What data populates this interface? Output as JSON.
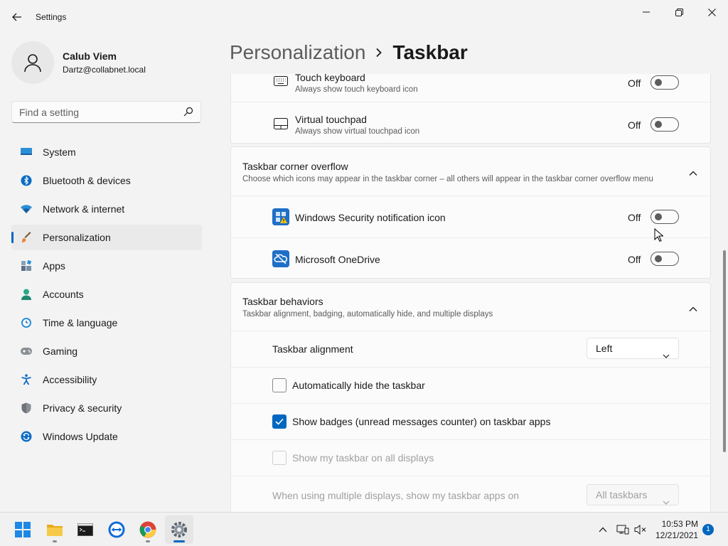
{
  "window": {
    "title": "Settings",
    "controls": {
      "minimize": "minimize-icon",
      "maximize": "restore-icon",
      "close": "close-icon"
    }
  },
  "profile": {
    "name": "Calub Viem",
    "email": "Dartz@collabnet.local",
    "avatar_icon": "person-icon"
  },
  "search": {
    "placeholder": "Find a setting",
    "value": ""
  },
  "sidebar": {
    "items": [
      {
        "label": "System",
        "icon": "system-icon",
        "active": false
      },
      {
        "label": "Bluetooth & devices",
        "icon": "bluetooth-icon",
        "active": false
      },
      {
        "label": "Network & internet",
        "icon": "wifi-icon",
        "active": false
      },
      {
        "label": "Personalization",
        "icon": "brush-icon",
        "active": true
      },
      {
        "label": "Apps",
        "icon": "apps-icon",
        "active": false
      },
      {
        "label": "Accounts",
        "icon": "accounts-icon",
        "active": false
      },
      {
        "label": "Time & language",
        "icon": "clock-icon",
        "active": false
      },
      {
        "label": "Gaming",
        "icon": "gamepad-icon",
        "active": false
      },
      {
        "label": "Accessibility",
        "icon": "accessibility-icon",
        "active": false
      },
      {
        "label": "Privacy & security",
        "icon": "shield-icon",
        "active": false
      },
      {
        "label": "Windows Update",
        "icon": "update-icon",
        "active": false
      }
    ]
  },
  "header": {
    "parent": "Personalization",
    "current": "Taskbar"
  },
  "taskbar_icons": {
    "items": [
      {
        "title": "Touch keyboard",
        "subtitle": "Always show touch keyboard icon",
        "state": "Off",
        "icon": "keyboard-icon"
      },
      {
        "title": "Virtual touchpad",
        "subtitle": "Always show virtual touchpad icon",
        "state": "Off",
        "icon": "touchpad-icon"
      }
    ]
  },
  "corner_overflow": {
    "title": "Taskbar corner overflow",
    "subtitle": "Choose which icons may appear in the taskbar corner – all others will appear in the taskbar corner overflow menu",
    "expanded": true,
    "items": [
      {
        "title": "Windows Security notification icon",
        "state": "Off",
        "icon": "windows-security-icon"
      },
      {
        "title": "Microsoft OneDrive",
        "state": "Off",
        "icon": "onedrive-icon"
      }
    ]
  },
  "behaviors": {
    "title": "Taskbar behaviors",
    "subtitle": "Taskbar alignment, badging, automatically hide, and multiple displays",
    "expanded": true,
    "alignment": {
      "label": "Taskbar alignment",
      "value": "Left"
    },
    "auto_hide": {
      "label": "Automatically hide the taskbar",
      "checked": false
    },
    "badges": {
      "label": "Show badges (unread messages counter) on taskbar apps",
      "checked": true
    },
    "all_displays": {
      "label": "Show my taskbar on all displays",
      "checked": false,
      "disabled": true
    },
    "multi_display": {
      "label": "When using multiple displays, show my taskbar apps on",
      "value": "All taskbars",
      "disabled": true
    }
  },
  "taskbar": {
    "apps": [
      {
        "name": "start-icon"
      },
      {
        "name": "file-explorer-icon"
      },
      {
        "name": "terminal-icon"
      },
      {
        "name": "teamviewer-icon"
      },
      {
        "name": "chrome-icon"
      },
      {
        "name": "settings-icon",
        "active": true
      }
    ],
    "tray": {
      "chevron": "chevron-up-icon",
      "network": "network-icon",
      "sound": "sound-muted-icon"
    },
    "clock": {
      "time": "10:53 PM",
      "date": "12/21/2021"
    },
    "notifications": "1"
  },
  "colors": {
    "accent": "#0067c0",
    "background": "#f3f3f3",
    "card": "#fbfbfb"
  }
}
